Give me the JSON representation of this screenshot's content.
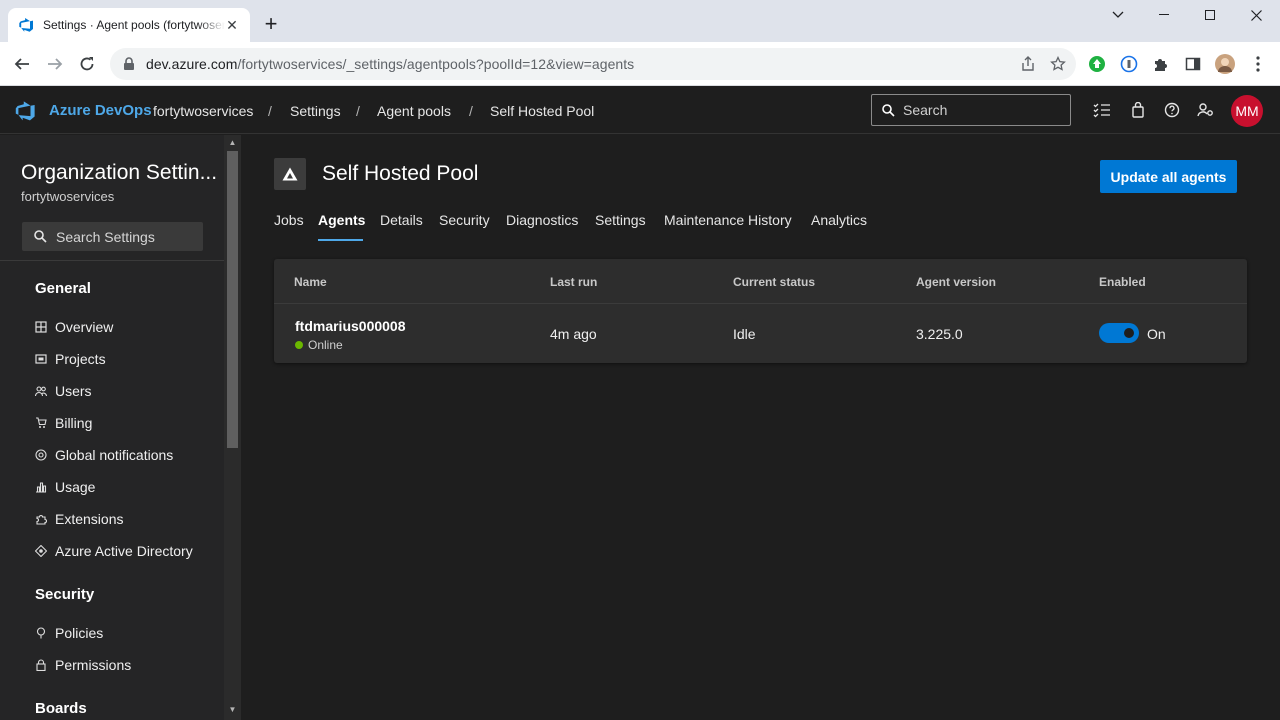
{
  "browser": {
    "tab_title": "Settings · Agent pools (fortytwoservices)",
    "url_host": "dev.azure.com",
    "url_path": "/fortytwoservices/_settings/agentpools?poolId=12&view=agents"
  },
  "topbar": {
    "brand": "Azure DevOps",
    "breadcrumbs": [
      "fortytwoservices",
      "Settings",
      "Agent pools",
      "Self Hosted Pool"
    ],
    "search_placeholder": "Search",
    "avatar_initials": "MM",
    "avatar_color": "#c8102e"
  },
  "sidebar": {
    "title": "Organization Settin...",
    "subtitle": "fortytwoservices",
    "search_placeholder": "Search Settings",
    "sections": [
      {
        "heading": "General",
        "items": [
          {
            "label": "Overview",
            "icon": "overview-icon"
          },
          {
            "label": "Projects",
            "icon": "projects-icon"
          },
          {
            "label": "Users",
            "icon": "users-icon"
          },
          {
            "label": "Billing",
            "icon": "billing-icon"
          },
          {
            "label": "Global notifications",
            "icon": "notifications-icon"
          },
          {
            "label": "Usage",
            "icon": "usage-icon"
          },
          {
            "label": "Extensions",
            "icon": "extensions-icon"
          },
          {
            "label": "Azure Active Directory",
            "icon": "azure-ad-icon"
          }
        ]
      },
      {
        "heading": "Security",
        "items": [
          {
            "label": "Policies",
            "icon": "policies-icon"
          },
          {
            "label": "Permissions",
            "icon": "permissions-icon"
          }
        ]
      },
      {
        "heading": "Boards",
        "items": []
      }
    ]
  },
  "main": {
    "pool_title": "Self Hosted Pool",
    "update_button": "Update all agents",
    "accent": "#0078d4",
    "tabs": [
      {
        "label": "Jobs"
      },
      {
        "label": "Agents",
        "active": true
      },
      {
        "label": "Details"
      },
      {
        "label": "Security"
      },
      {
        "label": "Diagnostics"
      },
      {
        "label": "Settings"
      },
      {
        "label": "Maintenance History"
      },
      {
        "label": "Analytics"
      }
    ],
    "table": {
      "columns": [
        "Name",
        "Last run",
        "Current status",
        "Agent version",
        "Enabled"
      ],
      "rows": [
        {
          "name": "ftdmarius000008",
          "online_status": "Online",
          "last_run": "4m ago",
          "current_status": "Idle",
          "agent_version": "3.225.0",
          "enabled": true,
          "enabled_label": "On"
        }
      ]
    },
    "status_online_color": "#6bb700"
  }
}
